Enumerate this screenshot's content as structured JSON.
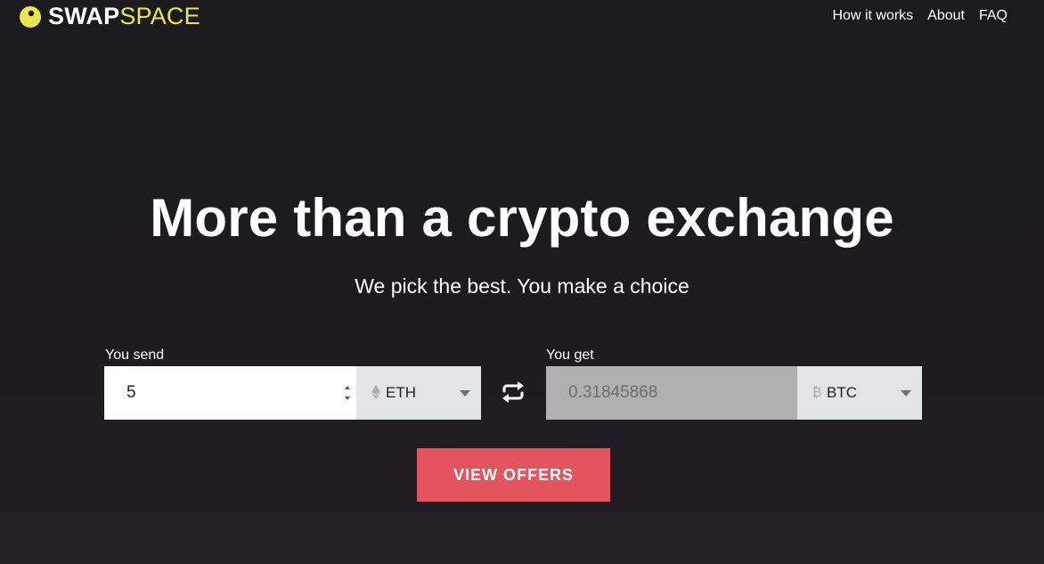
{
  "brand": {
    "name_bold": "SWAP",
    "name_light": "SPACE",
    "logo_color": "#e9e64f"
  },
  "nav": {
    "items": [
      {
        "label": "How it works"
      },
      {
        "label": "About"
      },
      {
        "label": "FAQ"
      }
    ]
  },
  "hero": {
    "title": "More than a crypto exchange",
    "subtitle": "We pick the best. You make a choice"
  },
  "exchange": {
    "send": {
      "label": "You send",
      "amount": "5",
      "currency": "ETH",
      "currency_icon": "ethereum-icon"
    },
    "get": {
      "label": "You get",
      "amount": "0.31845868",
      "currency": "BTC",
      "currency_icon": "bitcoin-icon"
    },
    "swap_icon": "swap-arrows-icon",
    "submit_label": "VIEW OFFERS",
    "submit_color": "#e3545f"
  }
}
